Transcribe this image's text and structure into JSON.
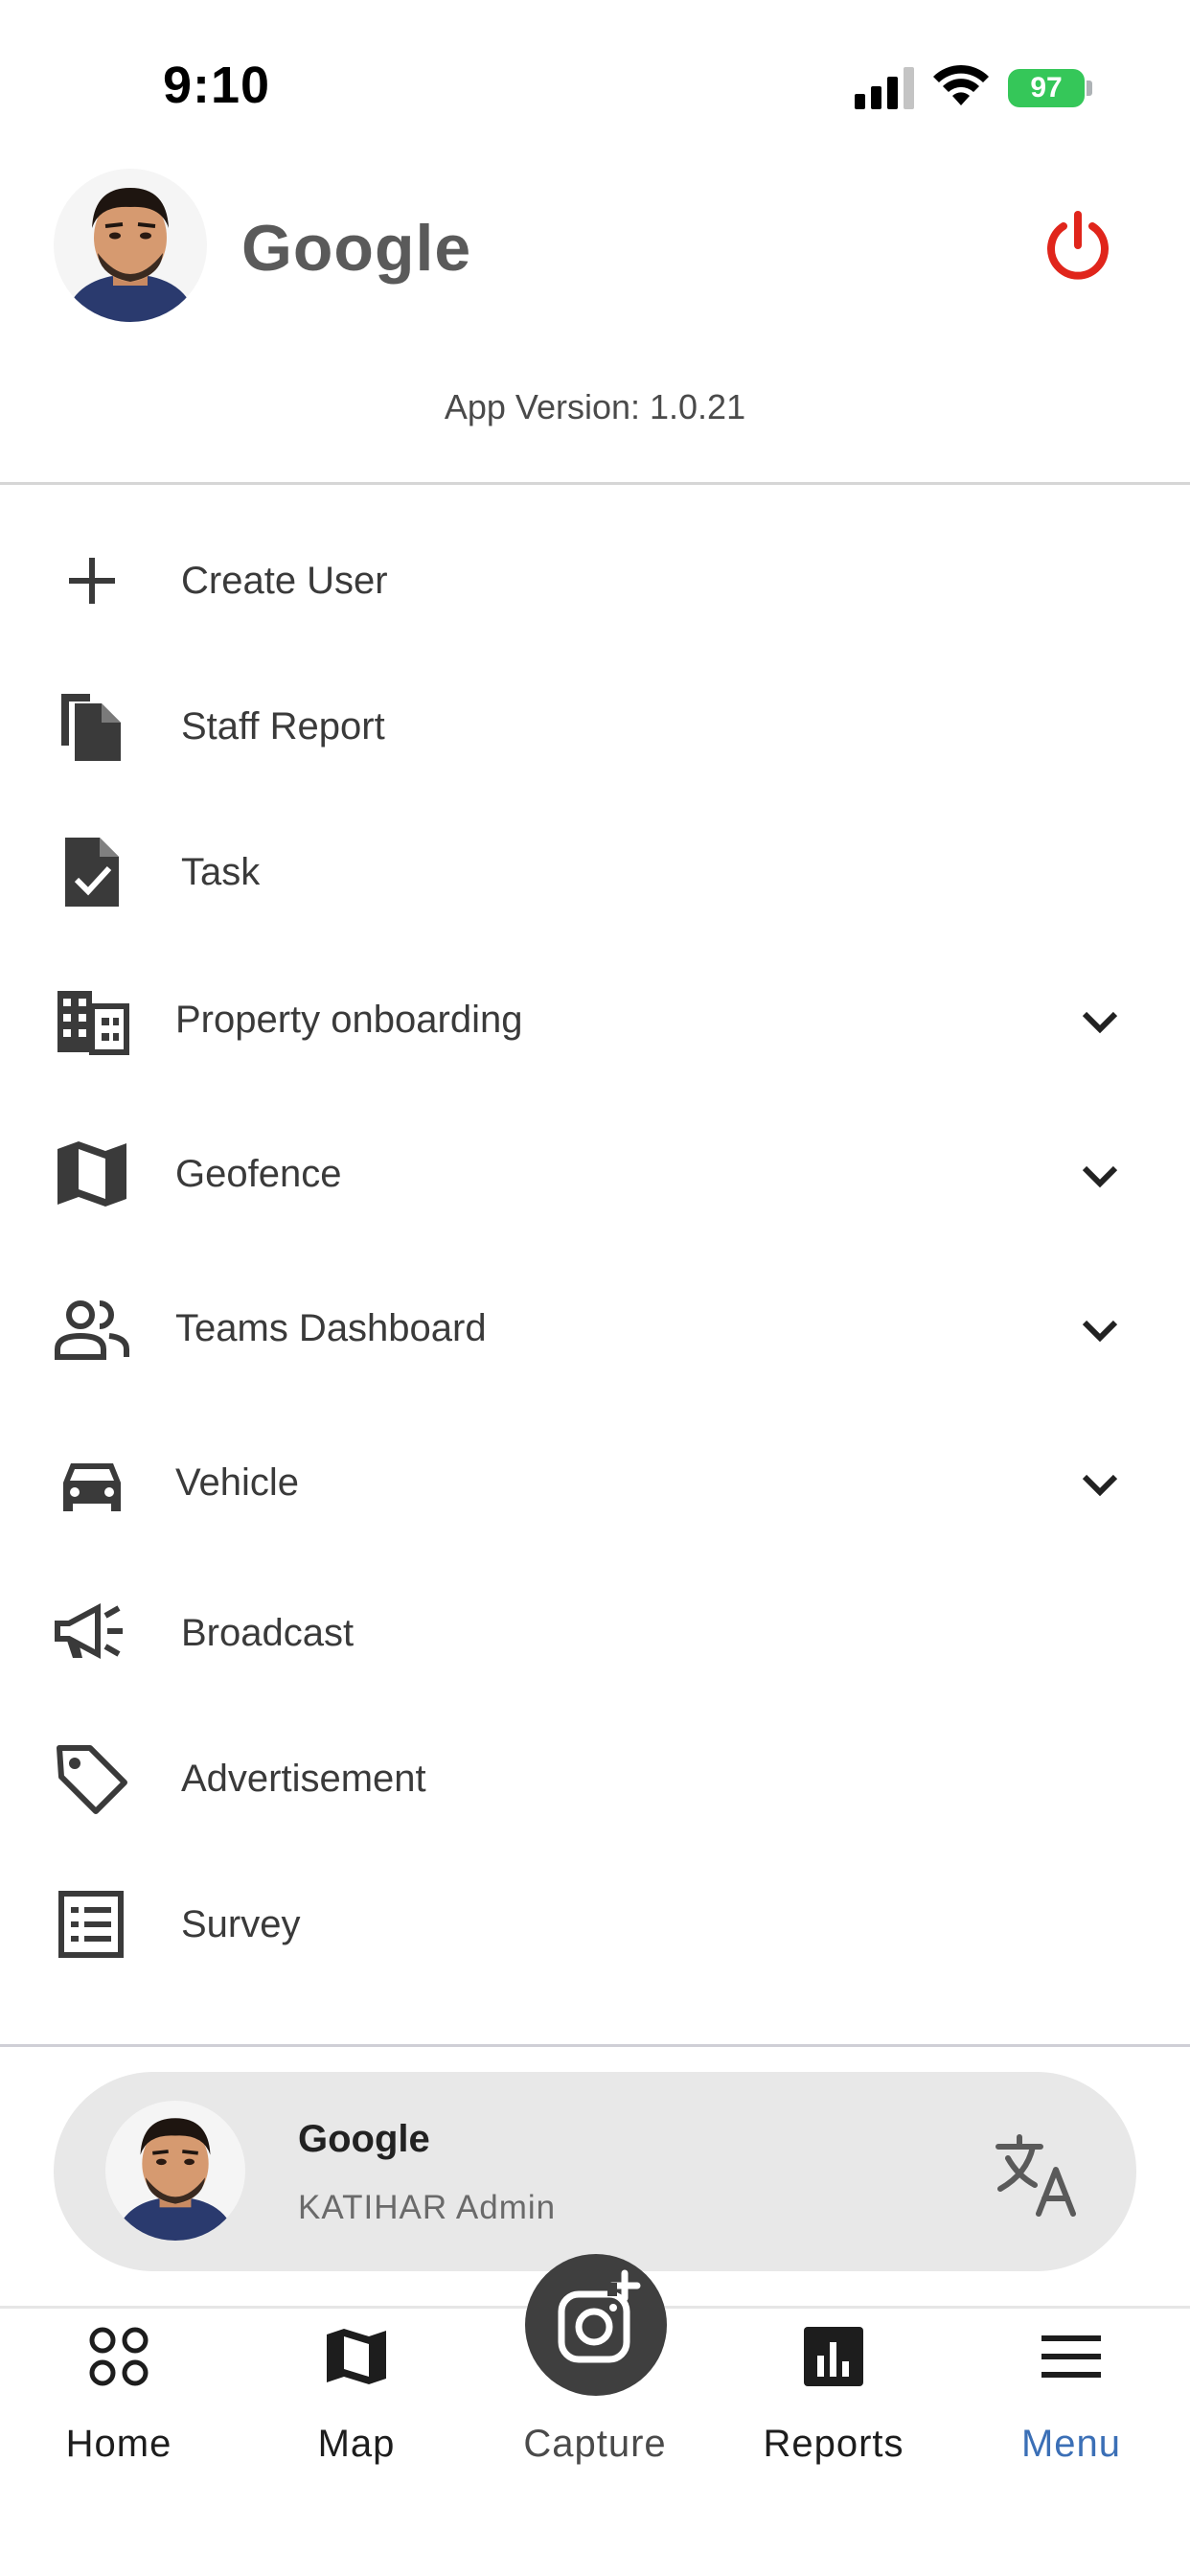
{
  "status_bar": {
    "time": "9:10",
    "battery": "97"
  },
  "header": {
    "name": "Google",
    "app_version": "App Version: 1.0.21"
  },
  "menu": {
    "items": [
      {
        "label": "Create User",
        "icon": "plus-icon",
        "expandable": false
      },
      {
        "label": "Staff Report",
        "icon": "file-copy-icon",
        "expandable": false
      },
      {
        "label": "Task",
        "icon": "task-icon",
        "expandable": false
      },
      {
        "label": "Property onboarding",
        "icon": "building-icon",
        "expandable": true
      },
      {
        "label": "Geofence",
        "icon": "map-icon",
        "expandable": true
      },
      {
        "label": "Teams Dashboard",
        "icon": "people-icon",
        "expandable": true
      },
      {
        "label": "Vehicle",
        "icon": "car-icon",
        "expandable": true
      },
      {
        "label": "Broadcast",
        "icon": "megaphone-icon",
        "expandable": false
      },
      {
        "label": "Advertisement",
        "icon": "tag-icon",
        "expandable": false
      },
      {
        "label": "Survey",
        "icon": "list-icon",
        "expandable": false
      }
    ]
  },
  "user_card": {
    "name": "Google",
    "role": "KATIHAR Admin"
  },
  "tabbar": {
    "home": "Home",
    "map": "Map",
    "capture": "Capture",
    "reports": "Reports",
    "menu": "Menu",
    "active": "Menu"
  },
  "colors": {
    "accent": "#3b6fb6",
    "power": "#e0251b",
    "battery": "#35c759",
    "card_bg": "#e8e8e8"
  }
}
